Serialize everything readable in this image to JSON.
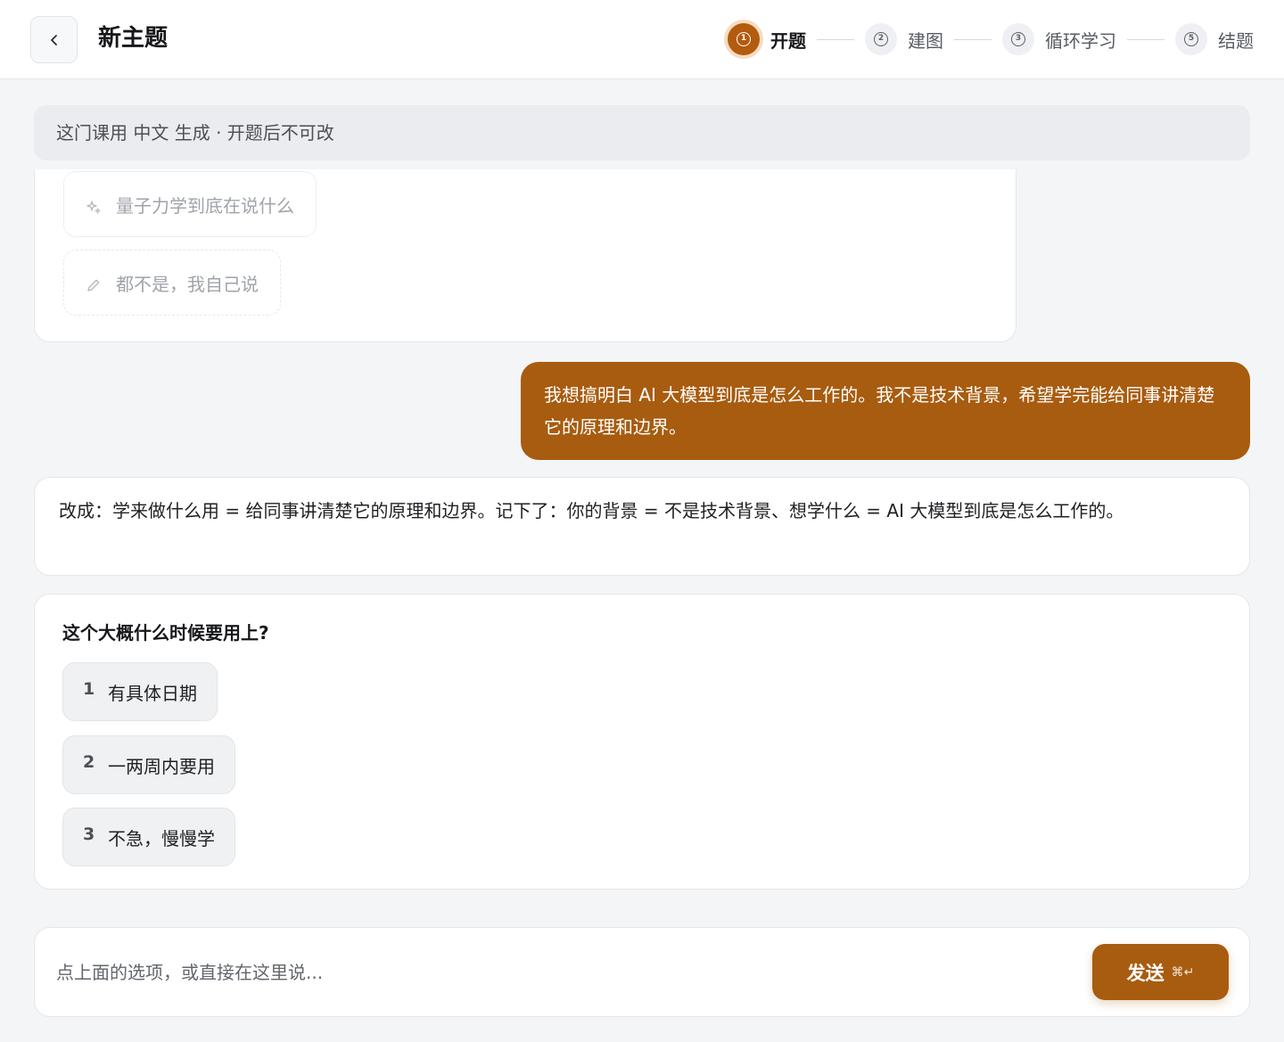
{
  "header": {
    "title": "新主题",
    "back_icon": "chevron-left-icon",
    "steps": [
      {
        "num": "1",
        "label": "开题",
        "active": true
      },
      {
        "num": "2",
        "label": "建图",
        "active": false
      },
      {
        "num": "3",
        "label": "循环学习",
        "active": false
      },
      {
        "num": "5",
        "label": "结题",
        "active": false
      }
    ]
  },
  "notice": "这门课用 中文 生成 · 开题后不可改",
  "previous_options": [
    {
      "icon": "sparkle-icon",
      "label": "量子力学到底在说什么"
    },
    {
      "icon": "pencil-icon",
      "label": "都不是，我自己说"
    }
  ],
  "user_message": "我想搞明白 AI 大模型到底是怎么工作的。我不是技术背景，希望学完能给同事讲清楚它的原理和边界。",
  "assistant_message": "改成：学来做什么用 = 给同事讲清楚它的原理和边界。记下了：你的背景 = 不是技术背景、想学什么 = AI 大模型到底是怎么工作的。",
  "question": {
    "title": "这个大概什么时候要用上?",
    "choices": [
      {
        "idx": "1",
        "label": "有具体日期"
      },
      {
        "idx": "2",
        "label": "一两周内要用"
      },
      {
        "idx": "3",
        "label": "不急，慢慢学"
      }
    ]
  },
  "composer": {
    "placeholder": "点上面的选项，或直接在这里说...",
    "value": "",
    "send_label": "发送",
    "shortcut": "⌘↵"
  },
  "colors": {
    "accent": "#a85c0f",
    "accent_ring": "#f6dcc1",
    "background": "#f4f5f7"
  }
}
